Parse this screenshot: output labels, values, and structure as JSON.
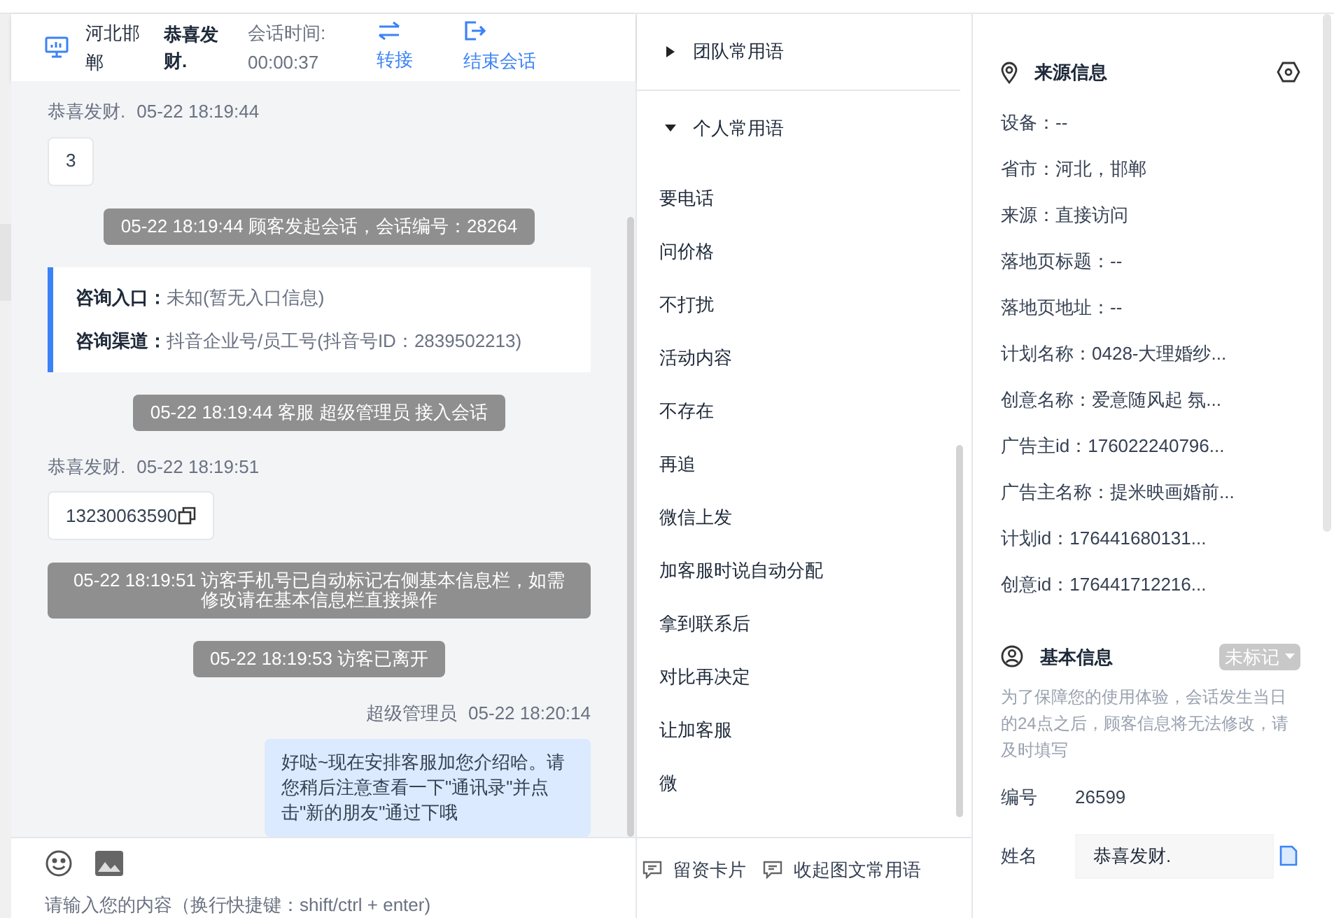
{
  "header": {
    "location": "河北邯郸",
    "customer": "恭喜发财.",
    "time_label": "会话时间:",
    "time_value": "00:00:37",
    "actions": [
      {
        "label": "转接",
        "kind": "transfer"
      },
      {
        "label": "结束会话",
        "kind": "exit"
      }
    ]
  },
  "messages": [
    {
      "kind": "customer",
      "sender": "恭喜发财.",
      "time": "05-22 18:19:44",
      "text": "3",
      "copyable": false
    },
    {
      "kind": "system",
      "text": "05-22 18:19:44 顾客发起会话，会话编号：28264"
    },
    {
      "kind": "info",
      "lines": [
        {
          "label": "咨询入口：",
          "value": "未知(暂无入口信息)"
        },
        {
          "label": "咨询渠道：",
          "value": "抖音企业号/员工号(抖音号ID：2839502213)"
        }
      ]
    },
    {
      "kind": "system",
      "text": "05-22 18:19:44 客服 超级管理员 接入会话"
    },
    {
      "kind": "customer",
      "sender": "恭喜发财.",
      "time": "05-22 18:19:51",
      "text": "13230063590",
      "copyable": true
    },
    {
      "kind": "system",
      "text": "05-22 18:19:51 访客手机号已自动标记右侧基本信息栏，如需修改请在基本信息栏直接操作"
    },
    {
      "kind": "system",
      "text": "05-22 18:19:53 访客已离开"
    },
    {
      "kind": "agent",
      "sender": "超级管理员",
      "time": "05-22 18:20:14",
      "text": "好哒~现在安排客服加您介绍哈。请您稍后注意查看一下\"通讯录\"并点击\"新的朋友\"通过下哦"
    }
  ],
  "input": {
    "placeholder": "请输入您的内容（换行快捷键：shift/ctrl + enter)"
  },
  "quick_buttons": [
    {
      "label": "留资卡片"
    },
    {
      "label": "收起图文常用语"
    }
  ],
  "phrase_groups": [
    {
      "label": "团队常用语",
      "expanded": false
    },
    {
      "label": "个人常用语",
      "expanded": true,
      "items": [
        "要电话",
        "问价格",
        "不打扰",
        "活动内容",
        "不存在",
        "再追",
        "微信上发",
        "加客服时说自动分配",
        "拿到联系后",
        "对比再决定",
        "让加客服",
        "微"
      ]
    }
  ],
  "source": {
    "title": "来源信息",
    "fields": [
      "设备：--",
      "省市：河北，邯郸",
      "来源：直接访问",
      "落地页标题：--",
      "落地页地址：--",
      "计划名称：0428-大理婚纱...",
      "创意名称：爱意随风起 氛...",
      "广告主id：176022240796...",
      "广告主名称：提米映画婚前...",
      "计划id：176441680131...",
      "创意id：176441712216..."
    ]
  },
  "basic": {
    "title": "基本信息",
    "tag": "未标记",
    "note": "为了保障您的使用体验，会话发生当日的24点之后，顾客信息将无法修改，请及时填写",
    "id_label": "编号",
    "id_value": "26599",
    "name_label": "姓名",
    "name_value": "恭喜发财."
  }
}
